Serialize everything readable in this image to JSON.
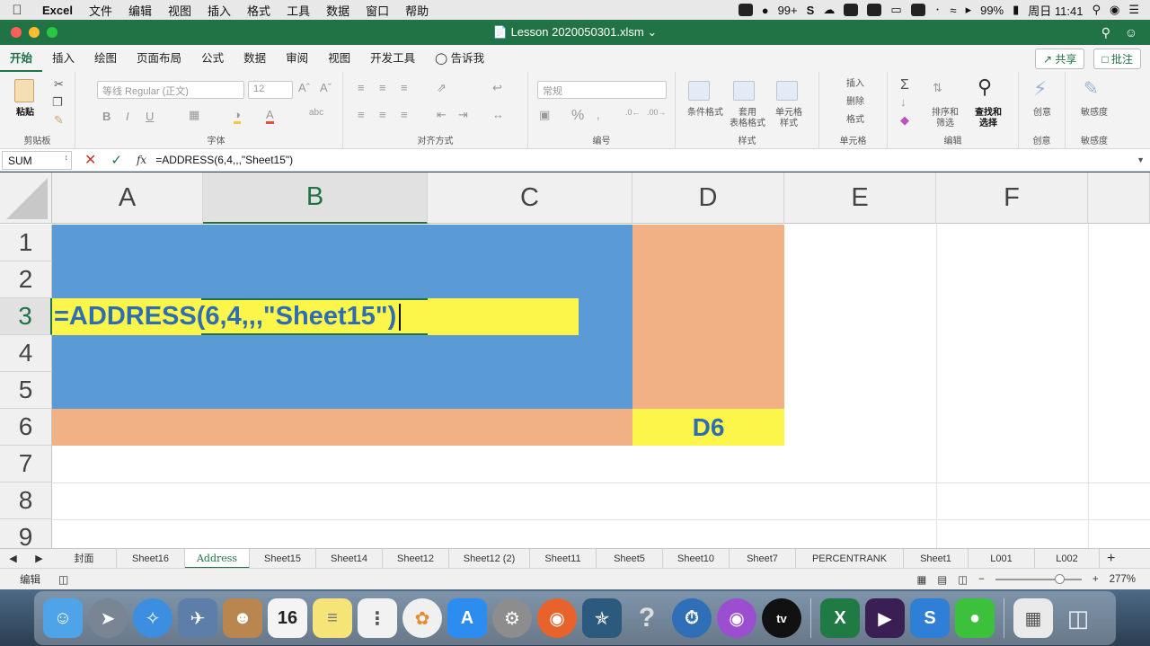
{
  "menubar": {
    "app": "Excel",
    "items": [
      "文件",
      "编辑",
      "视图",
      "插入",
      "格式",
      "工具",
      "数据",
      "窗口",
      "帮助"
    ],
    "notifications": "99+",
    "battery": "99%",
    "clock": "周日 11:41"
  },
  "window": {
    "title": "Lesson 2020050301.xlsm"
  },
  "ribbon": {
    "tabs": [
      "开始",
      "插入",
      "绘图",
      "页面布局",
      "公式",
      "数据",
      "审阅",
      "视图",
      "开发工具",
      "告诉我"
    ],
    "share": "共享",
    "comment": "批注",
    "clipboard": {
      "paste": "粘贴",
      "group": "剪贴板"
    },
    "font": {
      "name": "等线 Regular (正文)",
      "size": "12",
      "group": "字体"
    },
    "align": {
      "group": "对齐方式"
    },
    "number": {
      "format": "常规",
      "group": "编号"
    },
    "styles": {
      "cond": "条件格式",
      "table1": "套用",
      "table2": "表格格式",
      "cell1": "单元格",
      "cell2": "样式",
      "group": "样式"
    },
    "cells": {
      "insert": "插入",
      "delete": "删除",
      "format": "格式",
      "group": "单元格"
    },
    "edit": {
      "sort1": "排序和",
      "sort2": "筛选",
      "find1": "查找和",
      "find2": "选择",
      "group": "编辑"
    },
    "ideas": {
      "label": "创意",
      "group": "创意"
    },
    "sens": {
      "label": "敏感度",
      "group": "敏感度"
    }
  },
  "formula_bar": {
    "name_box": "SUM",
    "formula": "=ADDRESS(6,4,,,\"Sheet15\")"
  },
  "grid": {
    "columns": [
      "A",
      "B",
      "C",
      "D",
      "E",
      "F"
    ],
    "rows": [
      "1",
      "2",
      "3",
      "4",
      "5",
      "6",
      "7",
      "8",
      "9"
    ],
    "edit_text": "=ADDRESS(6,4,,,\"Sheet15\")",
    "d6_label": "D6"
  },
  "sheets": [
    "封面",
    "Sheet16",
    "Address",
    "Sheet15",
    "Sheet14",
    "Sheet12",
    "Sheet12 (2)",
    "Sheet11",
    "Sheet5",
    "Sheet10",
    "Sheet7",
    "PERCENTRANK",
    "Sheet1",
    "L001",
    "L002"
  ],
  "status": {
    "mode": "编辑",
    "zoom": "277%"
  },
  "colors": {
    "excel_green": "#217346",
    "blue_fill": "#5b9bd5",
    "orange_fill": "#f2b085",
    "yellow": "#fdf64a"
  }
}
